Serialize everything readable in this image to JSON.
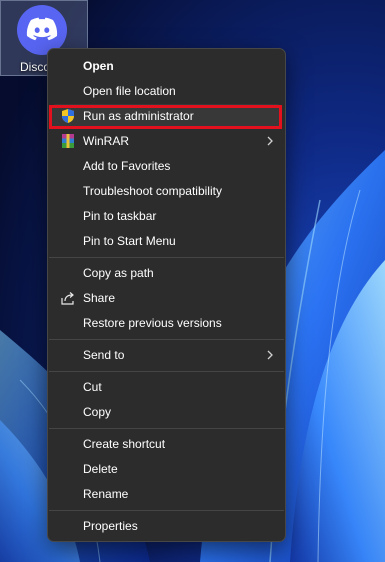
{
  "desktop": {
    "icon_label": "Disco",
    "icon_name": "discord-logo-icon",
    "icon_color": "#5865f2"
  },
  "context_menu": {
    "items": [
      {
        "label": "Open"
      },
      {
        "label": "Open file location"
      },
      {
        "label": "Run as administrator",
        "icon": "uac-shield-icon",
        "highlighted": true
      },
      {
        "label": "WinRAR",
        "icon": "winrar-icon",
        "submenu": true
      },
      {
        "label": "Add to Favorites"
      },
      {
        "label": "Troubleshoot compatibility"
      },
      {
        "label": "Pin to taskbar"
      },
      {
        "label": "Pin to Start Menu"
      },
      {
        "label": "Copy as path"
      },
      {
        "label": "Share",
        "icon": "share-icon"
      },
      {
        "label": "Restore previous versions"
      },
      {
        "label": "Send to",
        "submenu": true
      },
      {
        "label": "Cut"
      },
      {
        "label": "Copy"
      },
      {
        "label": "Create shortcut"
      },
      {
        "label": "Delete"
      },
      {
        "label": "Rename"
      },
      {
        "label": "Properties"
      }
    ],
    "highlight_color": "#e3101e",
    "background_color": "#2c2c2c"
  }
}
